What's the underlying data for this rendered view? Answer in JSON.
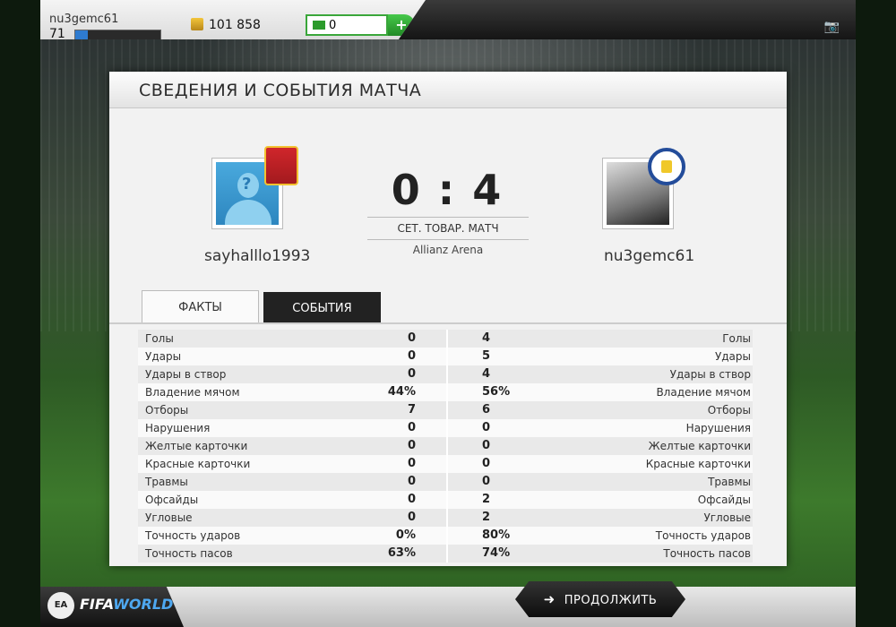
{
  "topbar": {
    "username": "nu3gemc61",
    "level": "71",
    "xp_fraction": 0.15,
    "coins": "101 858",
    "points": "0",
    "add_label": "+",
    "camera_icon": "camera-icon"
  },
  "panel": {
    "title": "СВЕДЕНИЯ И СОБЫТИЯ МАТЧА",
    "home_name": "sayhalllo1993",
    "away_name": "nu3gemc61",
    "score": "0 : 4",
    "match_type": "СЕТ. ТОВАР. МАТЧ",
    "venue": "Allianz Arena"
  },
  "tabs": {
    "facts": "ФАКТЫ",
    "events": "СОБЫТИЯ"
  },
  "stats": [
    {
      "label": "Голы",
      "home": "0",
      "away": "4"
    },
    {
      "label": "Удары",
      "home": "0",
      "away": "5"
    },
    {
      "label": "Удары в створ",
      "home": "0",
      "away": "4"
    },
    {
      "label": "Владение мячом",
      "home": "44%",
      "away": "56%"
    },
    {
      "label": "Отборы",
      "home": "7",
      "away": "6"
    },
    {
      "label": "Нарушения",
      "home": "0",
      "away": "0"
    },
    {
      "label": "Желтые карточки",
      "home": "0",
      "away": "0"
    },
    {
      "label": "Красные карточки",
      "home": "0",
      "away": "0"
    },
    {
      "label": "Травмы",
      "home": "0",
      "away": "0"
    },
    {
      "label": "Офсайды",
      "home": "0",
      "away": "2"
    },
    {
      "label": "Угловые",
      "home": "0",
      "away": "2"
    },
    {
      "label": "Точность ударов",
      "home": "0%",
      "away": "80%"
    },
    {
      "label": "Точность пасов",
      "home": "63%",
      "away": "74%"
    }
  ],
  "footer": {
    "continue_label": "ПРОДОЛЖИТЬ",
    "logo_ea": "EA",
    "logo_fifa": "FIFA",
    "logo_world": "WORLD"
  }
}
